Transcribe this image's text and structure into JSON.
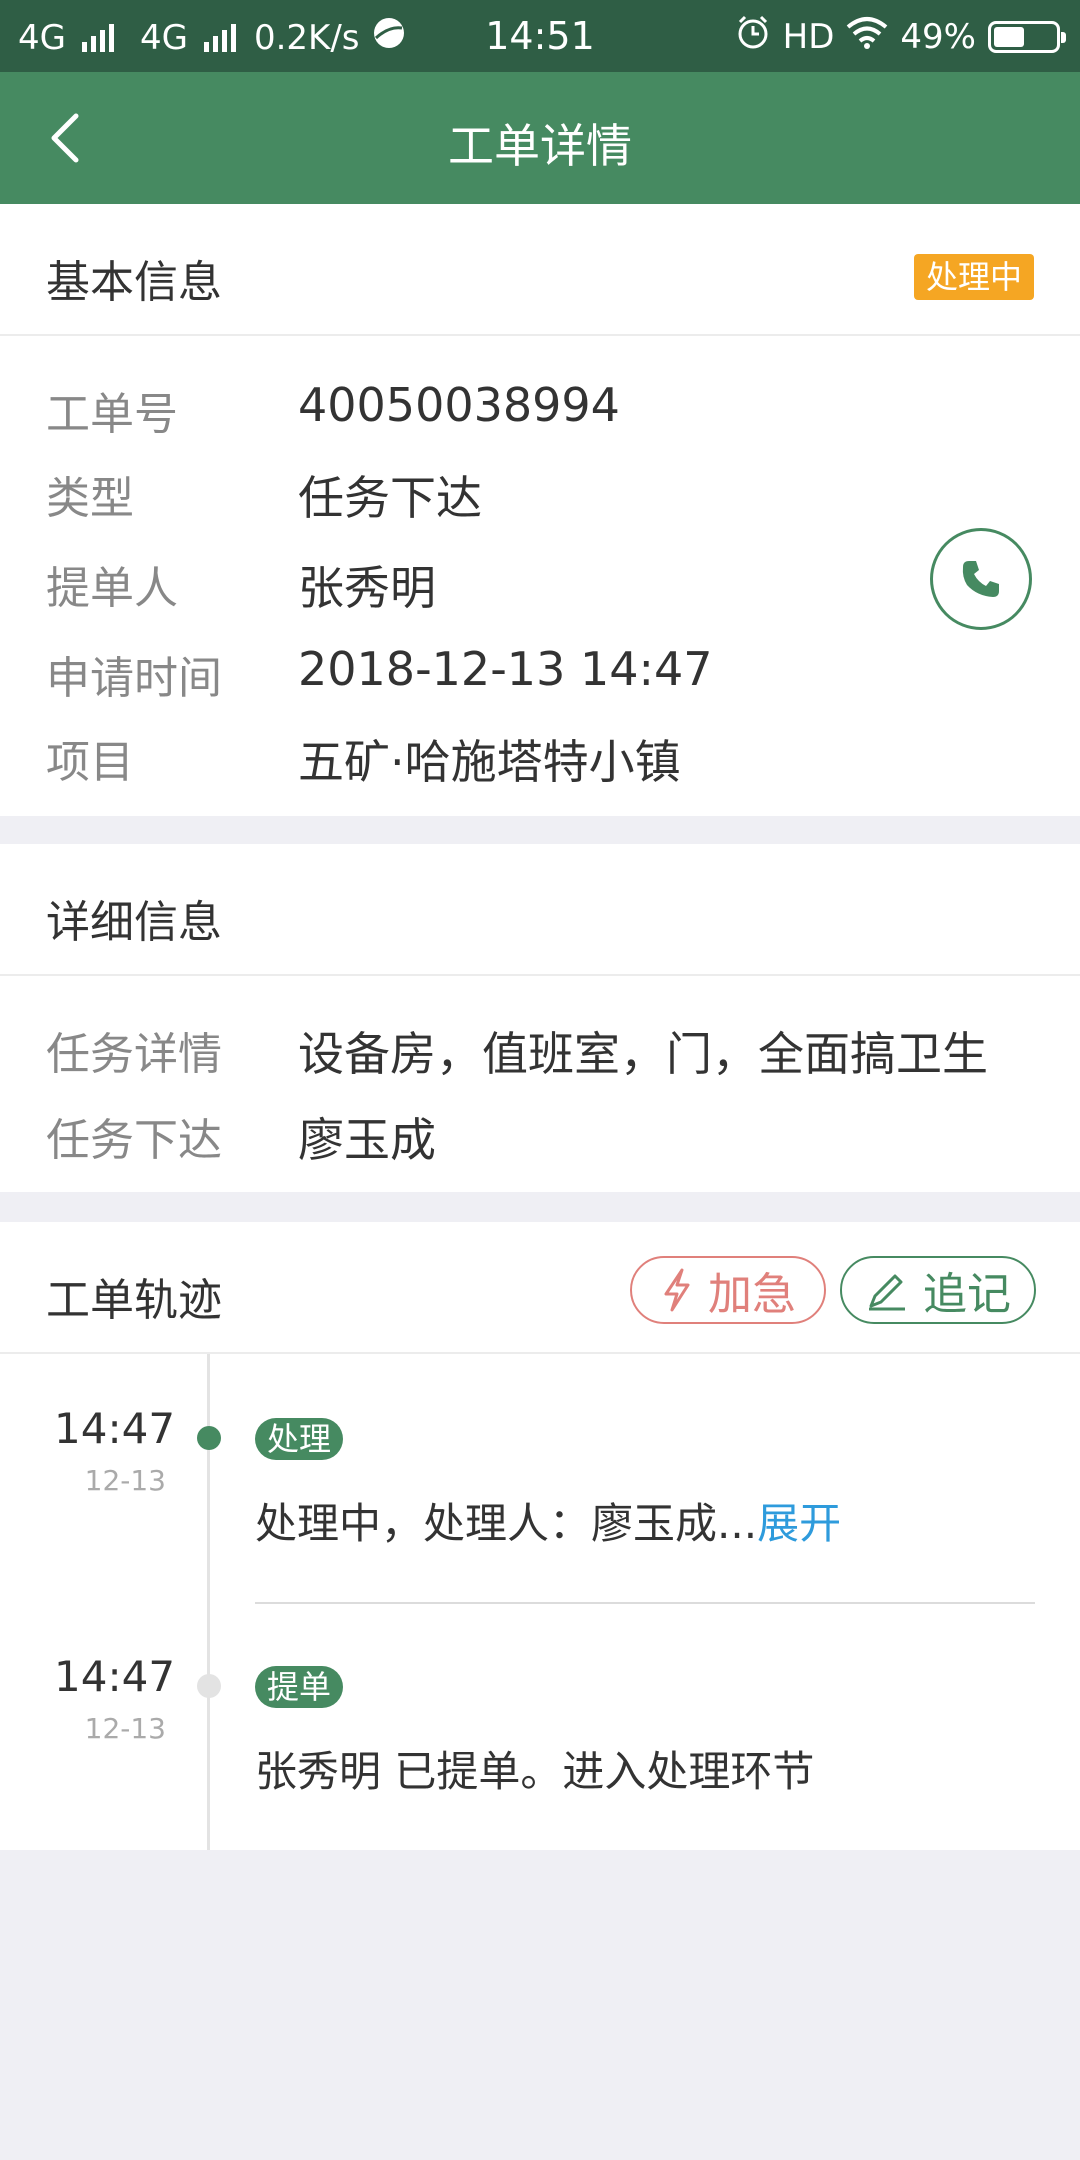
{
  "status_bar": {
    "network1": "4G",
    "network2": "4G",
    "speed": "0.2K/s",
    "time": "14:51",
    "hd": "HD",
    "battery": "49%",
    "battery_level": 0.49
  },
  "nav": {
    "title": "工单详情",
    "back_icon": "chevron-left-icon"
  },
  "basic_info": {
    "title": "基本信息",
    "status": "处理中",
    "status_color": "#f5a623",
    "rows": [
      {
        "label": "工单号",
        "value": "40050038994"
      },
      {
        "label": "类型",
        "value": "任务下达"
      },
      {
        "label": "提单人",
        "value": "张秀明"
      },
      {
        "label": "申请时间",
        "value": "2018-12-13 14:47"
      },
      {
        "label": "项目",
        "value": "五矿·哈施塔特小镇"
      }
    ],
    "phone_icon": "phone-icon"
  },
  "detail_info": {
    "title": "详细信息",
    "rows": [
      {
        "label": "任务详情",
        "value": "设备房，值班室，门，全面搞卫生"
      },
      {
        "label": "任务下达",
        "value": "廖玉成"
      }
    ]
  },
  "track": {
    "title": "工单轨迹",
    "urgent_label": "加急",
    "note_label": "追记",
    "items": [
      {
        "time": "14:47",
        "date": "12-13",
        "tag": "处理",
        "text": "处理中，处理人：廖玉成...",
        "expand": "展开",
        "active": true
      },
      {
        "time": "14:47",
        "date": "12-13",
        "tag": "提单",
        "text": "张秀明 已提单。进入处理环节",
        "active": false
      }
    ]
  },
  "colors": {
    "primary": "#468a61",
    "status_bar": "#2f5e45",
    "urgent": "#e0807b",
    "link": "#2e9bdc"
  }
}
